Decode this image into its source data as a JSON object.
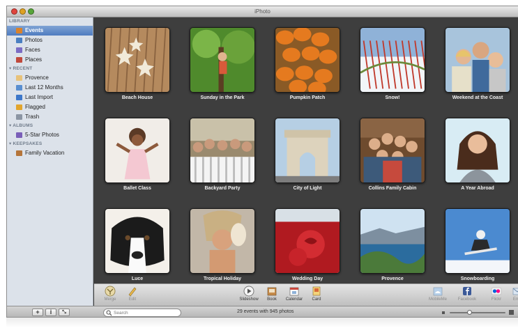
{
  "window": {
    "title": "iPhoto"
  },
  "sidebar": {
    "sections": [
      {
        "title": "LIBRARY",
        "items": [
          {
            "label": "Events",
            "icon": "events-icon",
            "selected": true
          },
          {
            "label": "Photos",
            "icon": "photos-icon"
          },
          {
            "label": "Faces",
            "icon": "faces-icon"
          },
          {
            "label": "Places",
            "icon": "places-icon"
          }
        ]
      },
      {
        "title": "RECENT",
        "items": [
          {
            "label": "Provence",
            "icon": "event-icon"
          },
          {
            "label": "Last 12 Months",
            "icon": "calendar-icon"
          },
          {
            "label": "Last Import",
            "icon": "import-icon"
          },
          {
            "label": "Flagged",
            "icon": "flag-icon"
          },
          {
            "label": "Trash",
            "icon": "trash-icon"
          }
        ]
      },
      {
        "title": "ALBUMS",
        "items": [
          {
            "label": "5-Star Photos",
            "icon": "smart-album-icon"
          }
        ]
      },
      {
        "title": "KEEPSAKES",
        "items": [
          {
            "label": "Family Vacation",
            "icon": "book-icon"
          }
        ]
      }
    ]
  },
  "events": [
    {
      "label": "Beach House"
    },
    {
      "label": "Sunday in the Park"
    },
    {
      "label": "Pumpkin Patch"
    },
    {
      "label": "Snow!"
    },
    {
      "label": "Weekend at the Coast"
    },
    {
      "label": "Ballet Class"
    },
    {
      "label": "Backyard Party"
    },
    {
      "label": "City of Light"
    },
    {
      "label": "Collins Family Cabin"
    },
    {
      "label": "A Year Abroad"
    },
    {
      "label": "Luce"
    },
    {
      "label": "Tropical Holiday"
    },
    {
      "label": "Wedding Day"
    },
    {
      "label": "Provence"
    },
    {
      "label": "Snowboarding"
    }
  ],
  "toolbar": {
    "left": [
      {
        "label": "Merge",
        "icon": "merge-icon"
      },
      {
        "label": "Edit",
        "icon": "pencil-icon"
      }
    ],
    "center": [
      {
        "label": "Slideshow",
        "icon": "play-icon"
      },
      {
        "label": "Book",
        "icon": "book-icon"
      },
      {
        "label": "Calendar",
        "icon": "calendar-icon"
      },
      {
        "label": "Card",
        "icon": "card-icon"
      }
    ],
    "right": [
      {
        "label": "MobileMe",
        "icon": "mobileme-icon"
      },
      {
        "label": "Facebook",
        "icon": "facebook-icon"
      },
      {
        "label": "Flickr",
        "icon": "flickr-icon"
      },
      {
        "label": "Ema",
        "icon": "email-icon"
      }
    ]
  },
  "statusbar": {
    "add": "+",
    "info": "i",
    "fullscreen": "⤡",
    "search_placeholder": "Search",
    "count": "29 events with 945 photos",
    "zoom_level": 0.35
  },
  "colors": {
    "content_bg": "#3e3e3e",
    "sidebar_bg": "#dce2ea",
    "selection": "#4f7cc0"
  }
}
